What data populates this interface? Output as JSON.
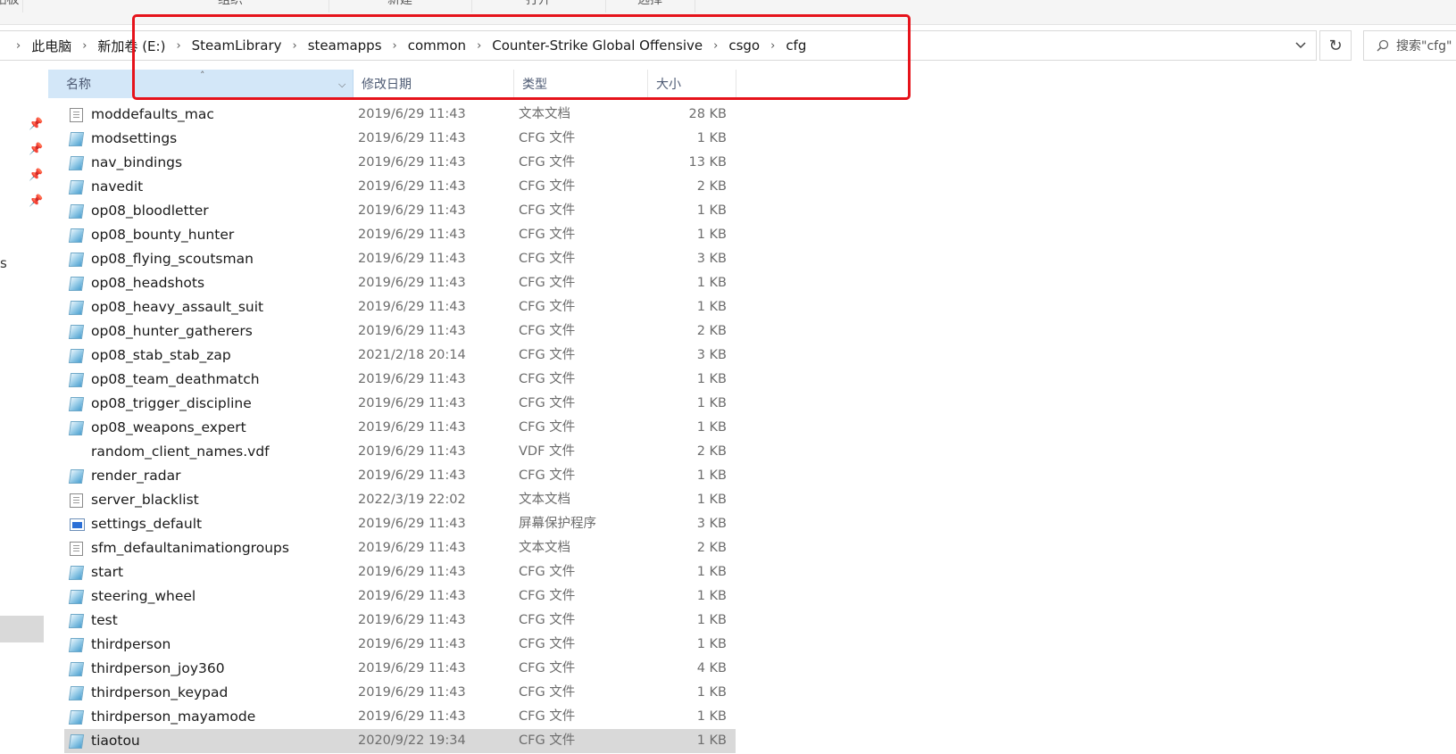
{
  "ribbon": {
    "groups": [
      "贴板",
      "组织",
      "新建",
      "打开",
      "选择"
    ]
  },
  "address": {
    "crumbs": [
      "此电脑",
      "新加卷 (E:)",
      "SteamLibrary",
      "steamapps",
      "common",
      "Counter-Strike Global Offensive",
      "csgo",
      "cfg"
    ],
    "search_placeholder": "搜索\"cfg\""
  },
  "nav": {
    "partial_label": "s"
  },
  "columns": {
    "name": "名称",
    "date": "修改日期",
    "type": "类型",
    "size": "大小"
  },
  "icons": {
    "cfg": "cfg-file-icon",
    "txt": "text-document-icon",
    "vdf": "blank-file-icon",
    "scr": "screensaver-icon"
  },
  "colors": {
    "highlight": "#e6131b",
    "header_selected": "#d3e7f8",
    "row_selected": "#d9d9d9"
  },
  "files": [
    {
      "name": "moddefaults_mac",
      "date": "2019/6/29 11:43",
      "type": "文本文档",
      "size": "28 KB",
      "icon": "txt"
    },
    {
      "name": "modsettings",
      "date": "2019/6/29 11:43",
      "type": "CFG 文件",
      "size": "1 KB",
      "icon": "cfg"
    },
    {
      "name": "nav_bindings",
      "date": "2019/6/29 11:43",
      "type": "CFG 文件",
      "size": "13 KB",
      "icon": "cfg"
    },
    {
      "name": "navedit",
      "date": "2019/6/29 11:43",
      "type": "CFG 文件",
      "size": "2 KB",
      "icon": "cfg"
    },
    {
      "name": "op08_bloodletter",
      "date": "2019/6/29 11:43",
      "type": "CFG 文件",
      "size": "1 KB",
      "icon": "cfg"
    },
    {
      "name": "op08_bounty_hunter",
      "date": "2019/6/29 11:43",
      "type": "CFG 文件",
      "size": "1 KB",
      "icon": "cfg"
    },
    {
      "name": "op08_flying_scoutsman",
      "date": "2019/6/29 11:43",
      "type": "CFG 文件",
      "size": "3 KB",
      "icon": "cfg"
    },
    {
      "name": "op08_headshots",
      "date": "2019/6/29 11:43",
      "type": "CFG 文件",
      "size": "1 KB",
      "icon": "cfg"
    },
    {
      "name": "op08_heavy_assault_suit",
      "date": "2019/6/29 11:43",
      "type": "CFG 文件",
      "size": "1 KB",
      "icon": "cfg"
    },
    {
      "name": "op08_hunter_gatherers",
      "date": "2019/6/29 11:43",
      "type": "CFG 文件",
      "size": "2 KB",
      "icon": "cfg"
    },
    {
      "name": "op08_stab_stab_zap",
      "date": "2021/2/18 20:14",
      "type": "CFG 文件",
      "size": "3 KB",
      "icon": "cfg"
    },
    {
      "name": "op08_team_deathmatch",
      "date": "2019/6/29 11:43",
      "type": "CFG 文件",
      "size": "1 KB",
      "icon": "cfg"
    },
    {
      "name": "op08_trigger_discipline",
      "date": "2019/6/29 11:43",
      "type": "CFG 文件",
      "size": "1 KB",
      "icon": "cfg"
    },
    {
      "name": "op08_weapons_expert",
      "date": "2019/6/29 11:43",
      "type": "CFG 文件",
      "size": "1 KB",
      "icon": "cfg"
    },
    {
      "name": "random_client_names.vdf",
      "date": "2019/6/29 11:43",
      "type": "VDF 文件",
      "size": "2 KB",
      "icon": "vdf"
    },
    {
      "name": "render_radar",
      "date": "2019/6/29 11:43",
      "type": "CFG 文件",
      "size": "1 KB",
      "icon": "cfg"
    },
    {
      "name": "server_blacklist",
      "date": "2022/3/19 22:02",
      "type": "文本文档",
      "size": "1 KB",
      "icon": "txt"
    },
    {
      "name": "settings_default",
      "date": "2019/6/29 11:43",
      "type": "屏幕保护程序",
      "size": "3 KB",
      "icon": "scr"
    },
    {
      "name": "sfm_defaultanimationgroups",
      "date": "2019/6/29 11:43",
      "type": "文本文档",
      "size": "2 KB",
      "icon": "txt"
    },
    {
      "name": "start",
      "date": "2019/6/29 11:43",
      "type": "CFG 文件",
      "size": "1 KB",
      "icon": "cfg"
    },
    {
      "name": "steering_wheel",
      "date": "2019/6/29 11:43",
      "type": "CFG 文件",
      "size": "1 KB",
      "icon": "cfg"
    },
    {
      "name": "test",
      "date": "2019/6/29 11:43",
      "type": "CFG 文件",
      "size": "1 KB",
      "icon": "cfg"
    },
    {
      "name": "thirdperson",
      "date": "2019/6/29 11:43",
      "type": "CFG 文件",
      "size": "1 KB",
      "icon": "cfg"
    },
    {
      "name": "thirdperson_joy360",
      "date": "2019/6/29 11:43",
      "type": "CFG 文件",
      "size": "4 KB",
      "icon": "cfg"
    },
    {
      "name": "thirdperson_keypad",
      "date": "2019/6/29 11:43",
      "type": "CFG 文件",
      "size": "1 KB",
      "icon": "cfg"
    },
    {
      "name": "thirdperson_mayamode",
      "date": "2019/6/29 11:43",
      "type": "CFG 文件",
      "size": "1 KB",
      "icon": "cfg"
    },
    {
      "name": "tiaotou",
      "date": "2020/9/22 19:34",
      "type": "CFG 文件",
      "size": "1 KB",
      "icon": "cfg",
      "selected": true
    }
  ]
}
